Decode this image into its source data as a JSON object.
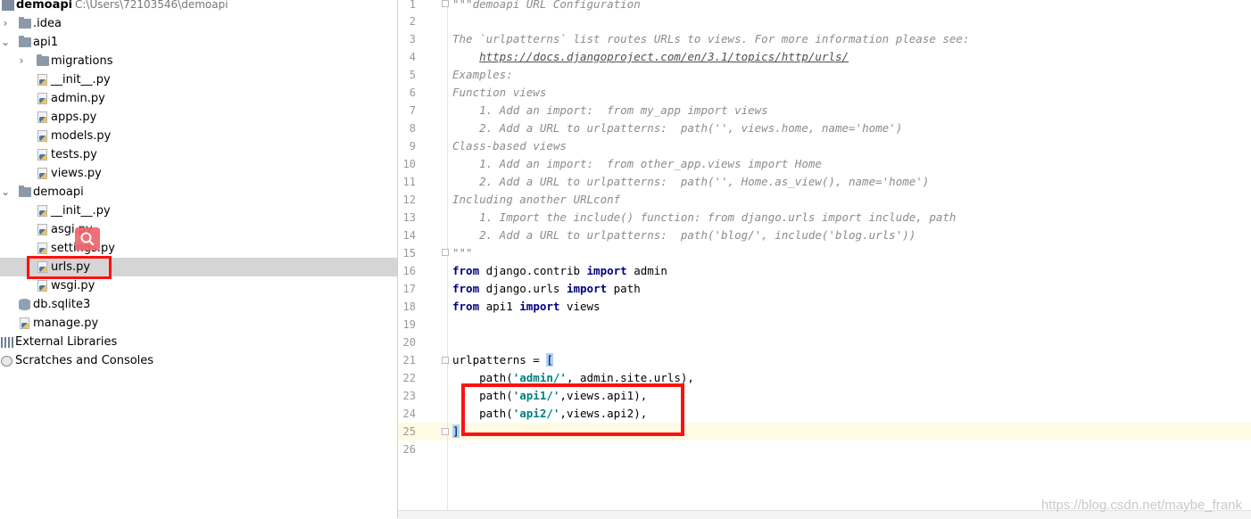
{
  "tree": {
    "project_name": "demoapi",
    "project_path": "C:\\Users\\72103546\\demoapi",
    "items": [
      {
        "label": "demoapi",
        "kind": "project"
      },
      {
        "label": ".idea",
        "kind": "folder"
      },
      {
        "label": "api1",
        "kind": "folder"
      },
      {
        "label": "migrations",
        "kind": "folder"
      },
      {
        "label": "__init__.py",
        "kind": "py"
      },
      {
        "label": "admin.py",
        "kind": "py"
      },
      {
        "label": "apps.py",
        "kind": "py"
      },
      {
        "label": "models.py",
        "kind": "py"
      },
      {
        "label": "tests.py",
        "kind": "py"
      },
      {
        "label": "views.py",
        "kind": "py"
      },
      {
        "label": "demoapi",
        "kind": "folder"
      },
      {
        "label": "__init__.py",
        "kind": "py"
      },
      {
        "label": "asgi.py",
        "kind": "py"
      },
      {
        "label": "settings.py",
        "kind": "py"
      },
      {
        "label": "urls.py",
        "kind": "py",
        "selected": true
      },
      {
        "label": "wsgi.py",
        "kind": "py"
      },
      {
        "label": "db.sqlite3",
        "kind": "db"
      },
      {
        "label": "manage.py",
        "kind": "py"
      },
      {
        "label": "External Libraries",
        "kind": "lib"
      },
      {
        "label": "Scratches and Consoles",
        "kind": "console"
      }
    ]
  },
  "editor": {
    "line_numbers": [
      "1",
      "2",
      "3",
      "4",
      "5",
      "6",
      "7",
      "8",
      "9",
      "10",
      "11",
      "12",
      "13",
      "14",
      "15",
      "16",
      "17",
      "18",
      "19",
      "20",
      "21",
      "22",
      "23",
      "24",
      "25",
      "26"
    ],
    "lines": [
      "\"\"\"demoapi URL Configuration",
      "",
      "The `urlpatterns` list routes URLs to views. For more information please see:",
      "    https://docs.djangoproject.com/en/3.1/topics/http/urls/",
      "Examples:",
      "Function views",
      "    1. Add an import:  from my_app import views",
      "    2. Add a URL to urlpatterns:  path('', views.home, name='home')",
      "Class-based views",
      "    1. Add an import:  from other_app.views import Home",
      "    2. Add a URL to urlpatterns:  path('', Home.as_view(), name='home')",
      "Including another URLconf",
      "    1. Import the include() function: from django.urls import include, path",
      "    2. Add a URL to urlpatterns:  path('blog/', include('blog.urls'))",
      "\"\"\"",
      "from django.contrib import admin",
      "from django.urls import path",
      "from api1 import views",
      "",
      "",
      "urlpatterns = [",
      "    path('admin/', admin.site.urls),",
      "    path('api1/',views.api1),",
      "    path('api2/',views.api2),",
      "]",
      ""
    ],
    "tokens": {
      "from": "from",
      "import": "import",
      "mod_contrib": " django.contrib ",
      "mod_admin": " admin",
      "mod_urls": " django.urls ",
      "mod_path": " path",
      "mod_api1": " api1 ",
      "mod_views": " views",
      "urlpatterns": "urlpatterns = ",
      "open_bracket": "[",
      "close_bracket": "]",
      "path_open": "    path(",
      "s_admin": "'admin/'",
      "admin_rest": ", admin.site.urls),",
      "s_api1": "'api1/'",
      "api1_rest": ",views.api1),",
      "s_api2": "'api2/'",
      "api2_rest": ",views.api2),",
      "doc_indent": "    ",
      "doc_link": "https://docs.djangoproject.com/en/3.1/topics/http/urls/"
    }
  },
  "watermark": "https://blog.csdn.net/maybe_frank",
  "colors": {
    "highlight_box": "#ff1010",
    "keyword": "#000080",
    "string": "#008080",
    "docstring": "#8c8c8c"
  }
}
